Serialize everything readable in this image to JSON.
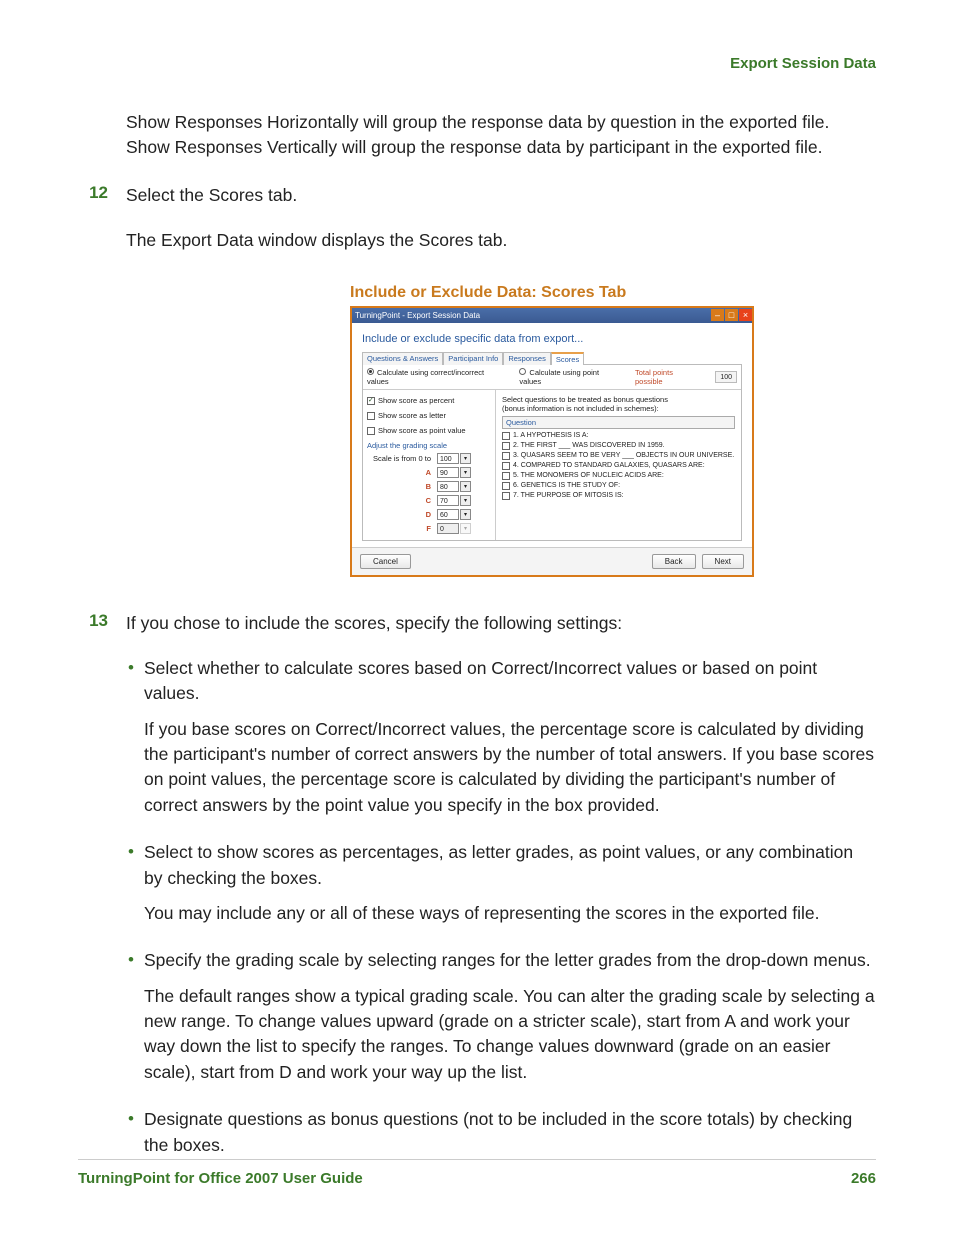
{
  "header": {
    "section": "Export Session Data"
  },
  "intro": "Show Responses Horizontally will group the response data by question in the exported file. Show Responses Vertically will group the response data by participant in the exported file.",
  "step12": {
    "num": "12",
    "text": "Select the Scores tab."
  },
  "step12_after": "The Export Data window displays the Scores tab.",
  "fig_caption": "Include or Exclude Data: Scores Tab",
  "dialog": {
    "title": "TurningPoint - Export Session Data",
    "heading": "Include or exclude specific data from export...",
    "tabs": [
      "Questions & Answers",
      "Participant Info",
      "Responses",
      "Scores"
    ],
    "calc_correct": "Calculate using correct/incorrect values",
    "calc_points": "Calculate using point values",
    "total_pts_label": "Total points possible",
    "total_pts_value": "100",
    "show_percent": "Show score as percent",
    "show_letter": "Show score as letter",
    "show_pointval": "Show score as point value",
    "adjust_link": "Adjust the grading scale",
    "scale_intro": "Scale is from 0 to",
    "grades": [
      {
        "letter": "",
        "val": "100"
      },
      {
        "letter": "A",
        "val": "90"
      },
      {
        "letter": "B",
        "val": "80"
      },
      {
        "letter": "C",
        "val": "70"
      },
      {
        "letter": "D",
        "val": "60"
      },
      {
        "letter": "F",
        "val": "0"
      }
    ],
    "bonus_hint1": "Select questions to be treated as bonus questions",
    "bonus_hint2": "(bonus information is not included in schemes):",
    "q_header": "Question",
    "questions": [
      "1.  A HYPOTHESIS IS A:",
      "2.  THE FIRST ___ WAS DISCOVERED IN 1959.",
      "3.  QUASARS SEEM TO BE VERY ___ OBJECTS IN OUR UNIVERSE.",
      "4.  COMPARED TO STANDARD GALAXIES, QUASARS ARE:",
      "5.  THE MONOMERS OF NUCLEIC ACIDS ARE:",
      "6.  GENETICS IS THE STUDY OF:",
      "7.  THE PURPOSE OF MITOSIS IS:"
    ],
    "btn_cancel": "Cancel",
    "btn_back": "Back",
    "btn_next": "Next"
  },
  "step13": {
    "num": "13",
    "text": "If you chose to include the scores, specify the following settings:"
  },
  "bullets": [
    {
      "lead": "Select whether to calculate scores based on Correct/Incorrect values or based on point values.",
      "sub": "If you base scores on Correct/Incorrect values, the percentage score is calculated by dividing the participant's number of correct answers by the number of total answers. If you base scores on point values, the percentage score is calculated by dividing the participant's number of correct answers by the point value you specify in the box provided."
    },
    {
      "lead": "Select to show scores as percentages, as letter grades, as point values, or any combination by checking the boxes.",
      "sub": "You may include any or all of these ways of representing the scores in the exported file."
    },
    {
      "lead": "Specify the grading scale by selecting ranges for the letter grades from the drop-down menus.",
      "sub": "The default ranges show a typical grading scale. You can alter the grading scale by selecting a new range. To change values upward (grade on a stricter scale), start from A and work your way down the list to specify the ranges. To change values downward (grade on an easier scale), start from D and work your way up the list."
    },
    {
      "lead": "Designate questions as bonus questions (not to be included in the score totals) by checking the boxes.",
      "sub": ""
    }
  ],
  "footer": {
    "left": "TurningPoint for Office 2007 User Guide",
    "right": "266"
  }
}
